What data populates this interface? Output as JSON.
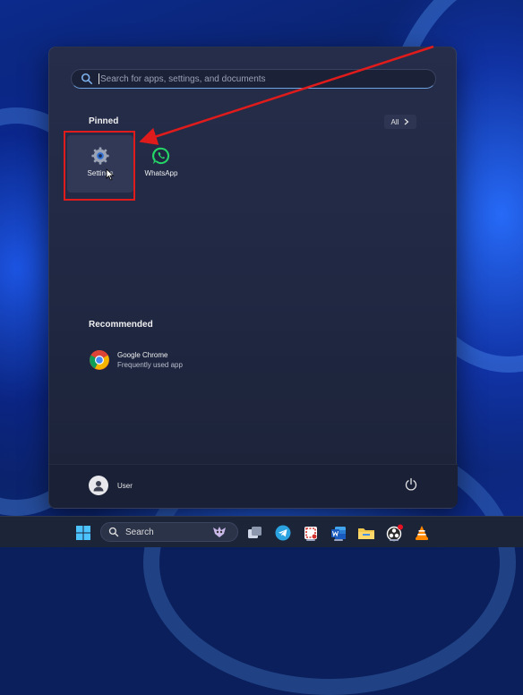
{
  "start_menu": {
    "search": {
      "placeholder": "Search for apps, settings, and documents"
    },
    "pinned": {
      "title": "Pinned",
      "all_label": "All",
      "apps": [
        {
          "label": "Settings",
          "icon": "gear-icon"
        },
        {
          "label": "WhatsApp",
          "icon": "whatsapp-icon"
        }
      ]
    },
    "recommended": {
      "title": "Recommended",
      "items": [
        {
          "name": "Google Chrome",
          "subtitle": "Frequently used app",
          "icon": "chrome-icon"
        }
      ]
    },
    "user": {
      "name": "User"
    }
  },
  "taskbar": {
    "search_label": "Search",
    "icons": [
      "windows-start-icon",
      "search-icon",
      "task-view-icon",
      "telegram-icon",
      "snipping-tool-icon",
      "word-icon",
      "file-explorer-icon",
      "obs-icon",
      "vlc-icon"
    ]
  },
  "annotation": {
    "color": "#e01b1b"
  }
}
